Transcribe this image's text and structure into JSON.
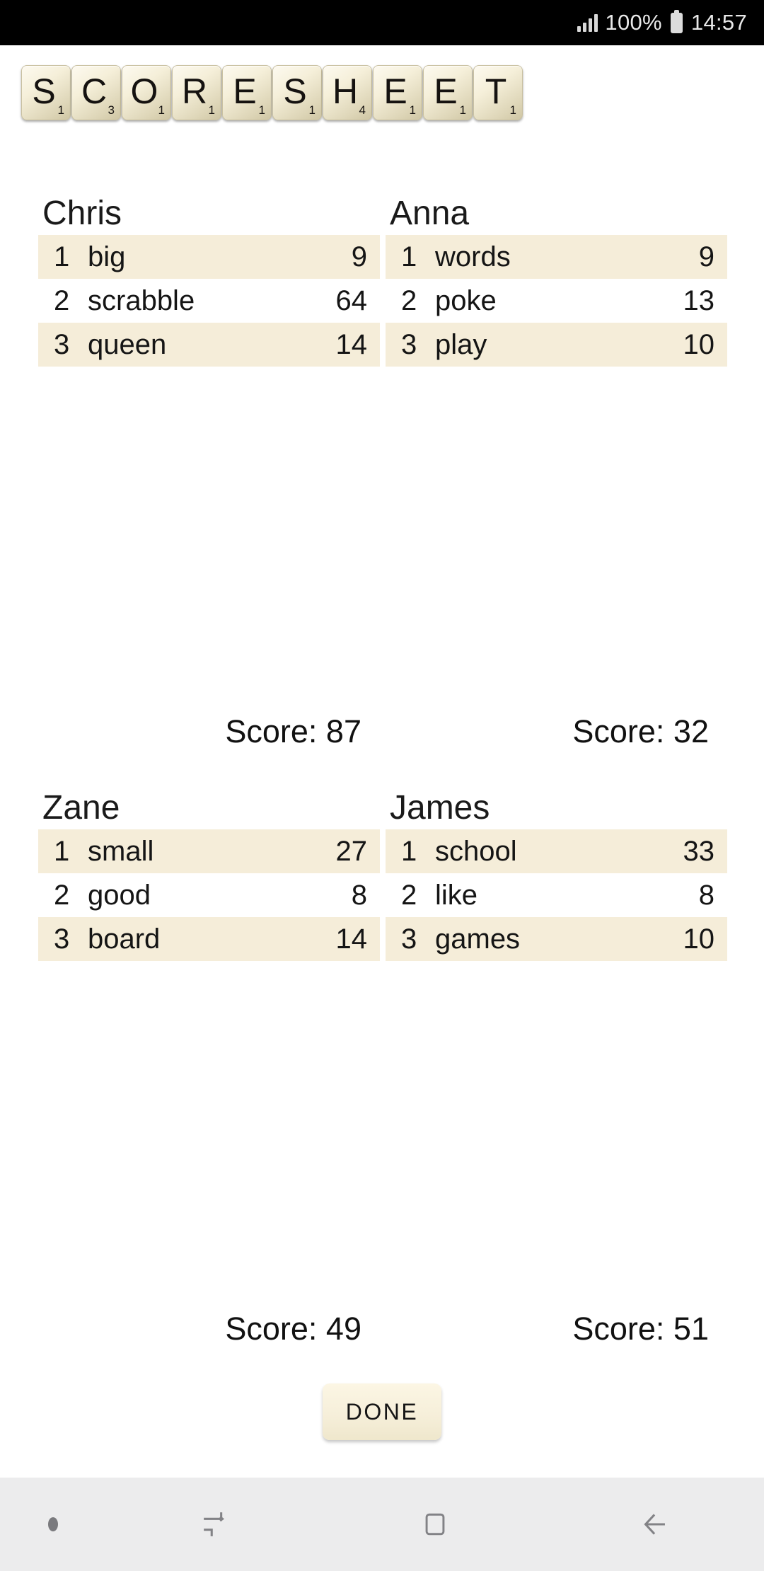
{
  "status_bar": {
    "signal_icon": "signal-bars-icon",
    "battery_text": "100%",
    "battery_icon": "battery-full-icon",
    "time": "14:57"
  },
  "logo": {
    "name": "SCORESHEET",
    "tiles": [
      {
        "letter": "S",
        "value": "1"
      },
      {
        "letter": "C",
        "value": "3"
      },
      {
        "letter": "O",
        "value": "1"
      },
      {
        "letter": "R",
        "value": "1"
      },
      {
        "letter": "E",
        "value": "1"
      },
      {
        "letter": "S",
        "value": "1"
      },
      {
        "letter": "H",
        "value": "4"
      },
      {
        "letter": "E",
        "value": "1"
      },
      {
        "letter": "E",
        "value": "1"
      },
      {
        "letter": "T",
        "value": "1"
      }
    ]
  },
  "players": [
    {
      "name": "Chris",
      "rows": [
        {
          "index": "1",
          "word": "big",
          "score": "9"
        },
        {
          "index": "2",
          "word": "scrabble",
          "score": "64"
        },
        {
          "index": "3",
          "word": "queen",
          "score": "14"
        }
      ],
      "total_label": "Score: 87"
    },
    {
      "name": "Anna",
      "rows": [
        {
          "index": "1",
          "word": "words",
          "score": "9"
        },
        {
          "index": "2",
          "word": "poke",
          "score": "13"
        },
        {
          "index": "3",
          "word": "play",
          "score": "10"
        }
      ],
      "total_label": "Score: 32"
    },
    {
      "name": "Zane",
      "rows": [
        {
          "index": "1",
          "word": "small",
          "score": "27"
        },
        {
          "index": "2",
          "word": "good",
          "score": "8"
        },
        {
          "index": "3",
          "word": "board",
          "score": "14"
        }
      ],
      "total_label": "Score: 49"
    },
    {
      "name": "James",
      "rows": [
        {
          "index": "1",
          "word": "school",
          "score": "33"
        },
        {
          "index": "2",
          "word": "like",
          "score": "8"
        },
        {
          "index": "3",
          "word": "games",
          "score": "10"
        }
      ],
      "total_label": "Score: 51"
    }
  ],
  "done_button": {
    "label": "DONE"
  },
  "nav_bar": {
    "items": [
      {
        "icon": "dot-indicator-icon",
        "label": ""
      },
      {
        "icon": "recents-icon",
        "label": ""
      },
      {
        "icon": "home-icon",
        "label": ""
      },
      {
        "icon": "back-arrow-icon",
        "label": ""
      }
    ]
  },
  "colors": {
    "row_alt": "#f5edd9",
    "tile_face": "#f5efd9",
    "status_bar": "#000000",
    "nav_bar": "#ececed"
  }
}
